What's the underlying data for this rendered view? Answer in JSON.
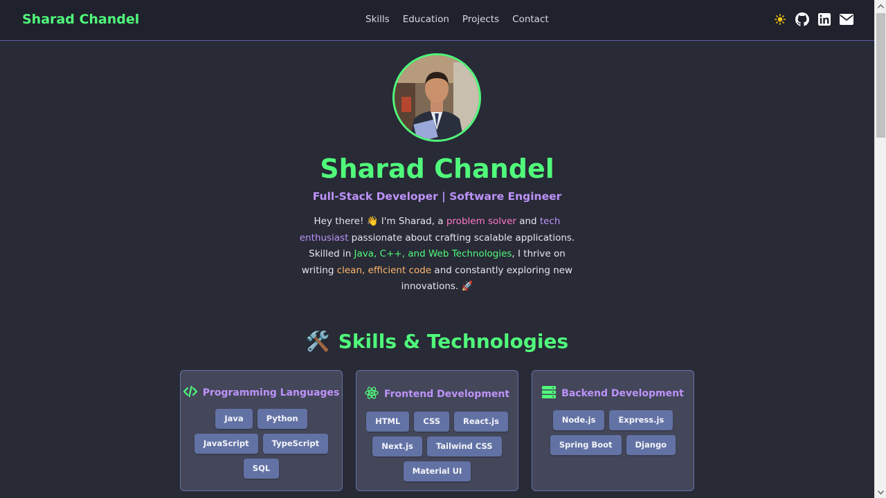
{
  "navbar": {
    "brand": "Sharad Chandel",
    "links": [
      "Skills",
      "Education",
      "Projects",
      "Contact"
    ],
    "icons": [
      "sun-icon",
      "github-icon",
      "linkedin-icon",
      "mail-icon"
    ]
  },
  "hero": {
    "name": "Sharad Chandel",
    "role": "Full-Stack Developer | Software Engineer",
    "bio": {
      "p1": "Hey there! 👋 I'm Sharad, a ",
      "h1": "problem solver",
      "p2": " and ",
      "h2": "tech enthusiast",
      "p3": " passionate about crafting scalable applications. Skilled in ",
      "h3": "Java, C++, and Web Technologies",
      "p4": ", I thrive on writing ",
      "h4": "clean, efficient code",
      "p5": " and constantly exploring new innovations. 🚀"
    }
  },
  "skills": {
    "emoji": "🛠️",
    "title": "Skills & Technologies",
    "cards": [
      {
        "title": "Programming Languages",
        "icon": "code-icon",
        "tags": [
          "Java",
          "Python",
          "JavaScript",
          "TypeScript",
          "SQL"
        ]
      },
      {
        "title": "Frontend Development",
        "icon": "react-icon",
        "tags": [
          "HTML",
          "CSS",
          "React.js",
          "Next.js",
          "Tailwind CSS",
          "Material UI"
        ]
      },
      {
        "title": "Backend Development",
        "icon": "server-icon",
        "tags": [
          "Node.js",
          "Express.js",
          "Spring Boot",
          "Django"
        ]
      }
    ]
  },
  "colors": {
    "background": "#282a36",
    "accent_green": "#50fa7b",
    "accent_purple": "#bd93f9",
    "accent_pink": "#ff79c6",
    "accent_orange": "#ffb86c",
    "card": "#44475a",
    "tag": "#6272a4"
  }
}
